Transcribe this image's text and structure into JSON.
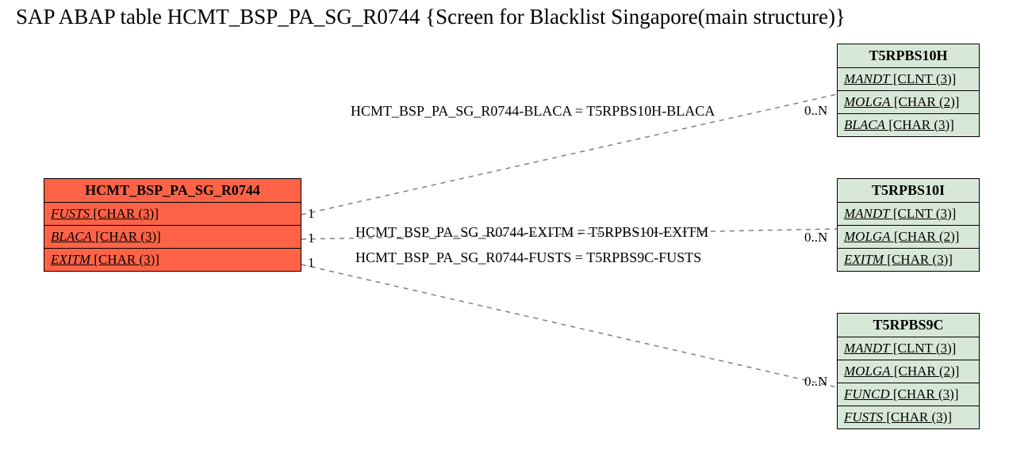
{
  "title": "SAP ABAP table HCMT_BSP_PA_SG_R0744 {Screen  for Blacklist Singapore(main structure)}",
  "main_table": {
    "name": "HCMT_BSP_PA_SG_R0744",
    "rows": [
      {
        "field": "FUSTS",
        "type": "[CHAR (3)]"
      },
      {
        "field": "BLACA",
        "type": "[CHAR (3)]"
      },
      {
        "field": "EXITM",
        "type": "[CHAR (3)]"
      }
    ]
  },
  "ref_tables": [
    {
      "name": "T5RPBS10H",
      "rows": [
        {
          "field": "MANDT",
          "type": "[CLNT (3)]"
        },
        {
          "field": "MOLGA",
          "type": "[CHAR (2)]"
        },
        {
          "field": "BLACA",
          "type": "[CHAR (3)]"
        }
      ]
    },
    {
      "name": "T5RPBS10I",
      "rows": [
        {
          "field": "MANDT",
          "type": "[CLNT (3)]"
        },
        {
          "field": "MOLGA",
          "type": "[CHAR (2)]"
        },
        {
          "field": "EXITM",
          "type": "[CHAR (3)]"
        }
      ]
    },
    {
      "name": "T5RPBS9C",
      "rows": [
        {
          "field": "MANDT",
          "type": "[CLNT (3)]"
        },
        {
          "field": "MOLGA",
          "type": "[CHAR (2)]"
        },
        {
          "field": "FUNCD",
          "type": "[CHAR (3)]"
        },
        {
          "field": "FUSTS",
          "type": "[CHAR (3)]"
        }
      ]
    }
  ],
  "relations": [
    {
      "label": "HCMT_BSP_PA_SG_R0744-BLACA = T5RPBS10H-BLACA",
      "left_card": "1",
      "right_card": "0..N"
    },
    {
      "label": "HCMT_BSP_PA_SG_R0744-EXITM = T5RPBS10I-EXITM",
      "left_card": "1",
      "right_card": "0..N"
    },
    {
      "label": "HCMT_BSP_PA_SG_R0744-FUSTS = T5RPBS9C-FUSTS",
      "left_card": "1",
      "right_card": "0..N"
    }
  ]
}
